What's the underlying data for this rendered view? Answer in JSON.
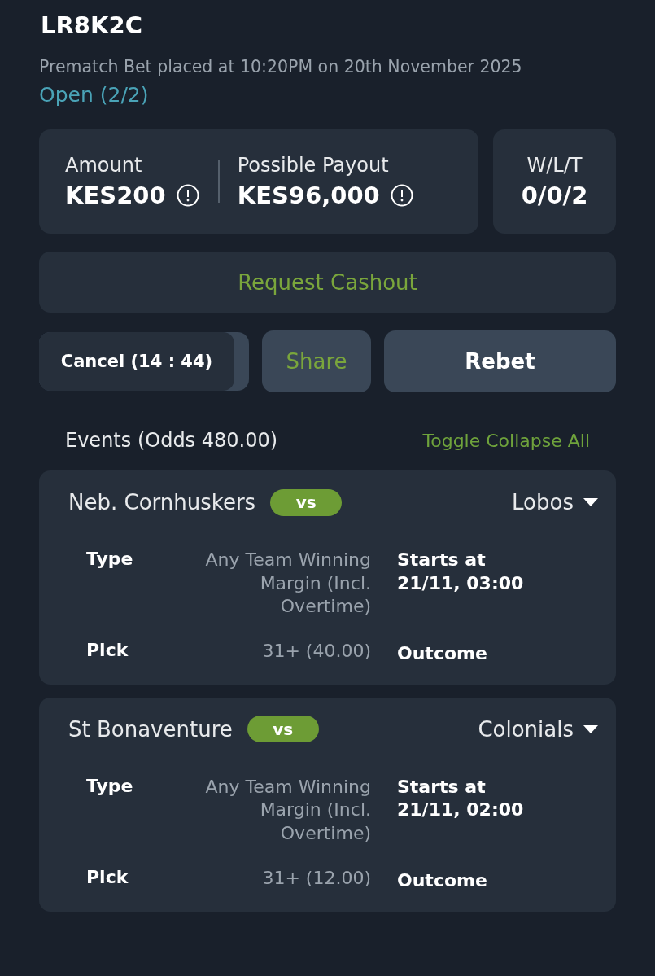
{
  "bet_id": "LR8K2C",
  "placed_info": "Prematch Bet placed at 10:20PM on 20th November 2025",
  "status": "Open (2/2)",
  "summary": {
    "amount_label": "Amount",
    "amount": "KES200",
    "payout_label": "Possible Payout",
    "payout": "KES96,000",
    "wlt_label": "W/L/T",
    "wlt": "0/0/2"
  },
  "cashout_button": "Request Cashout",
  "cancel_button": {
    "label": "Cancel (14 : 44)",
    "level": 0.93
  },
  "share_button": "Share",
  "rebet_button": "Rebet",
  "events_title": "Events (Odds 480.00)",
  "toggle_collapse": "Toggle Collapse All",
  "events": [
    {
      "home": "Neb. Cornhuskers",
      "vs": "vs",
      "away": "Lobos",
      "expanded": true,
      "type_label": "Type",
      "type": "Any Team Winning Margin (Incl. Overtime)",
      "start": "Starts at 21/11, 03:00",
      "pick_label": "Pick",
      "pick": "31+ (40.00)",
      "outcome": "Outcome"
    },
    {
      "home": "St Bonaventure",
      "vs": "vs",
      "away": "Colonials",
      "expanded": true,
      "type_label": "Type",
      "type": "Any Team Winning Margin (Incl. Overtime)",
      "start": "Starts at 21/11, 02:00",
      "pick_label": "Pick",
      "pick": "31+ (12.00)",
      "outcome": "Outcome"
    }
  ]
}
